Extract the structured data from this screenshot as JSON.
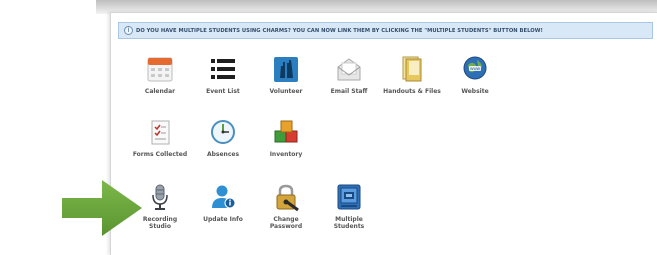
{
  "notice": {
    "icon": "info-icon",
    "text": "DO YOU HAVE MULTIPLE STUDENTS USING CHARMS? YOU CAN NOW LINK THEM BY CLICKING THE \"MULTIPLE STUDENTS\" BUTTON BELOW!"
  },
  "tiles": [
    {
      "label": "Calendar",
      "icon": "calendar-icon"
    },
    {
      "label": "Event List",
      "icon": "list-icon"
    },
    {
      "label": "Volunteer",
      "icon": "volunteer-hands-icon"
    },
    {
      "label": "Email Staff",
      "icon": "email-icon"
    },
    {
      "label": "Handouts & Files",
      "icon": "folder-icon"
    },
    {
      "label": "Website",
      "icon": "globe-icon"
    },
    {
      "label": "Forms Collected",
      "icon": "checklist-icon"
    },
    {
      "label": "Absences",
      "icon": "clock-icon"
    },
    {
      "label": "Inventory",
      "icon": "boxes-icon"
    },
    {
      "label": "Recording\nStudio",
      "icon": "microphone-icon"
    },
    {
      "label": "Update Info",
      "icon": "user-info-icon"
    },
    {
      "label": "Change\nPassword",
      "icon": "padlock-icon"
    },
    {
      "label": "Multiple\nStudents",
      "icon": "multiple-students-icon"
    }
  ],
  "colors": {
    "arrow": "#6aa637",
    "notice_bg": "#d9e8f6",
    "label_text": "#555555"
  }
}
